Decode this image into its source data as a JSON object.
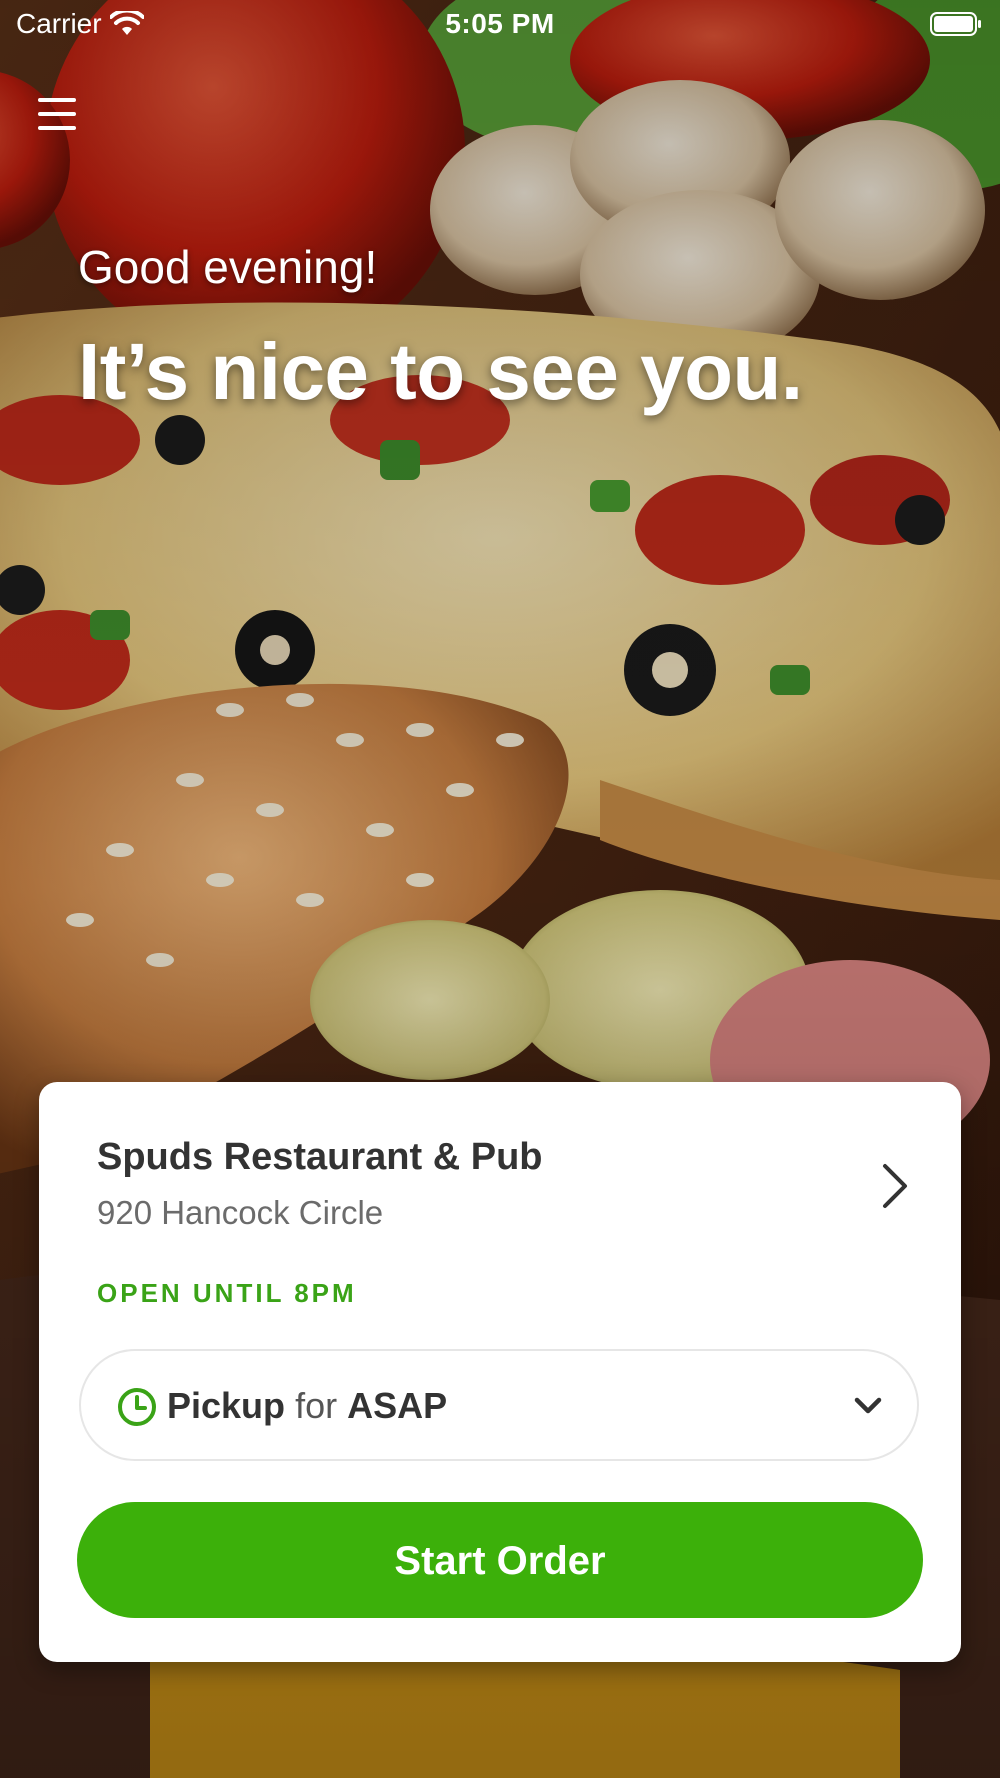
{
  "status_bar": {
    "carrier": "Carrier",
    "time": "5:05 PM"
  },
  "header": {
    "menu_icon": "hamburger-menu-icon"
  },
  "hero": {
    "greeting": "Good evening!",
    "headline": "It’s nice to see you.",
    "background_image": "pizza-and-burger-photo"
  },
  "location_card": {
    "restaurant_name": "Spuds Restaurant & Pub",
    "address": "920 Hancock Circle",
    "hours_status": "OPEN UNTIL 8PM",
    "order_mode": {
      "type": "Pickup",
      "connector": "for",
      "time": "ASAP"
    },
    "start_button_label": "Start Order"
  },
  "colors": {
    "accent_green": "#3cb00a",
    "status_green": "#3aa317"
  }
}
